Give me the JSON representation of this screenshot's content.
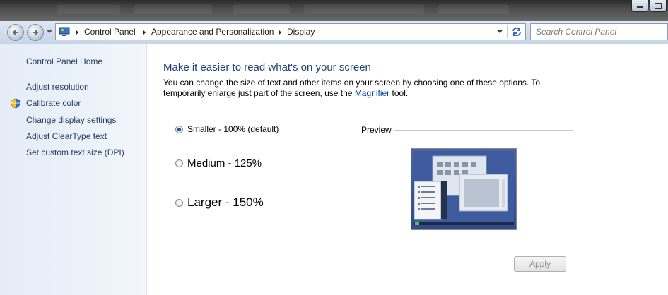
{
  "breadcrumbs": [
    "Control Panel",
    "Appearance and Personalization",
    "Display"
  ],
  "search": {
    "placeholder": "Search Control Panel"
  },
  "sidebar": {
    "items": [
      {
        "label": "Control Panel Home"
      },
      {
        "label": "Adjust resolution"
      },
      {
        "label": "Calibrate color",
        "icon": "shield-icon"
      },
      {
        "label": "Change display settings"
      },
      {
        "label": "Adjust ClearType text"
      },
      {
        "label": "Set custom text size (DPI)"
      }
    ]
  },
  "main": {
    "heading": "Make it easier to read what's on your screen",
    "desc_before": "You can change the size of text and other items on your screen by choosing one of these options. To temporarily enlarge just part of the screen, use the ",
    "desc_link": "Magnifier",
    "desc_after": " tool.",
    "options": [
      {
        "label": "Smaller - 100% (default)",
        "selected": true
      },
      {
        "label": "Medium - 125%",
        "selected": false
      },
      {
        "label": "Larger - 150%",
        "selected": false
      }
    ],
    "preview_label": "Preview",
    "apply_label": "Apply"
  },
  "colors": {
    "heading": "#1e3f75",
    "link": "#0645ad",
    "sidebar_bg": "#e4ecf7"
  }
}
